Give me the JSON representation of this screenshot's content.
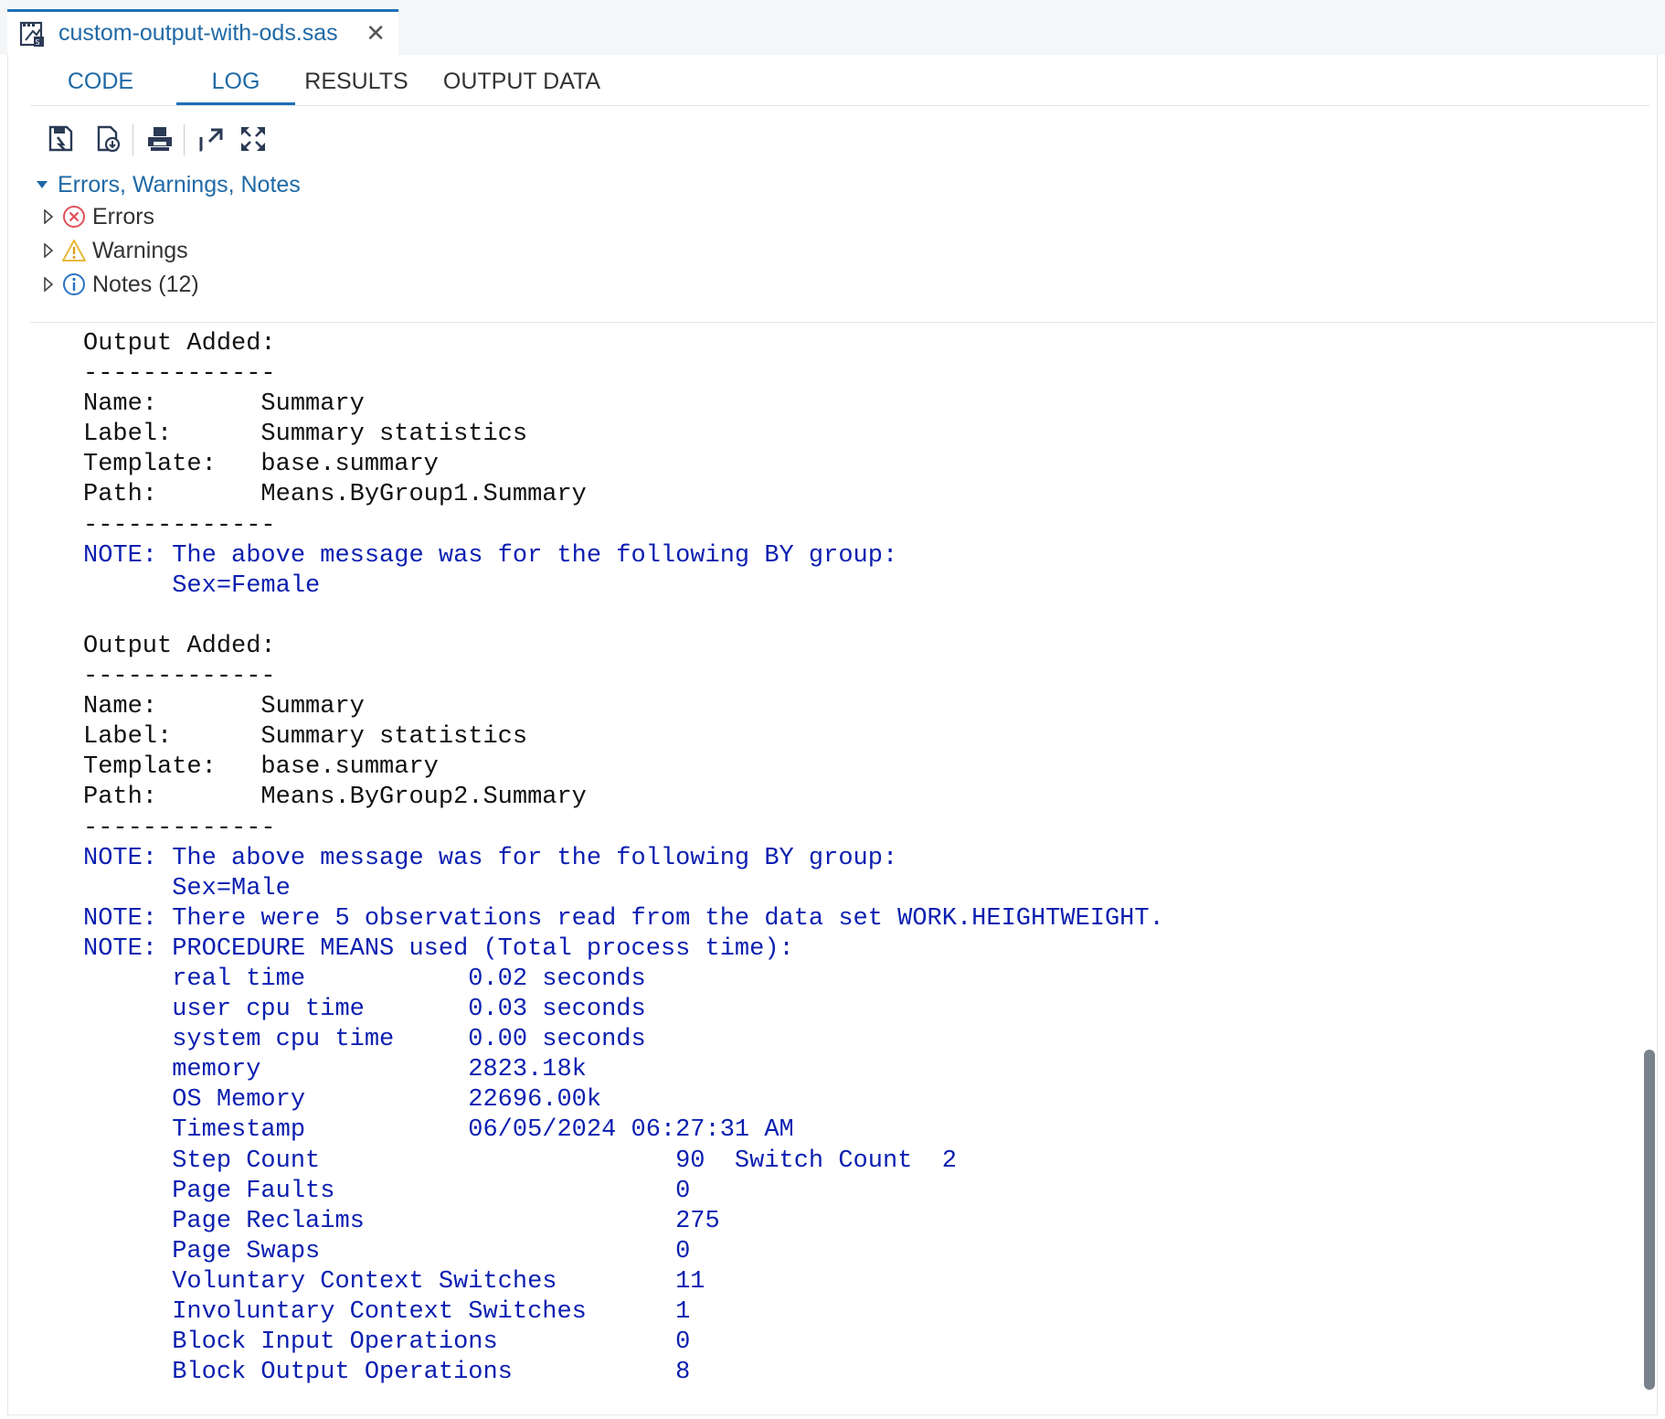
{
  "file_tab": {
    "name": "custom-output-with-ods.sas",
    "close_glyph": "✕"
  },
  "subtabs": {
    "code": "CODE",
    "log": "LOG",
    "results": "RESULTS",
    "output_data": "OUTPUT DATA",
    "active": "LOG"
  },
  "toolbar": {
    "icons": [
      "save-log-icon",
      "download-log-icon",
      "print-icon",
      "popout-icon",
      "maximize-icon"
    ]
  },
  "tree": {
    "root": "Errors, Warnings, Notes",
    "errors": "Errors",
    "warnings": "Warnings",
    "notes": "Notes (12)"
  },
  "log": [
    {
      "text": "Output Added:",
      "type": "plain"
    },
    {
      "text": "-------------",
      "type": "plain"
    },
    {
      "text": "Name:       Summary",
      "type": "plain"
    },
    {
      "text": "Label:      Summary statistics",
      "type": "plain"
    },
    {
      "text": "Template:   base.summary",
      "type": "plain"
    },
    {
      "text": "Path:       Means.ByGroup1.Summary",
      "type": "plain"
    },
    {
      "text": "-------------",
      "type": "plain"
    },
    {
      "text": "NOTE: The above message was for the following BY group:",
      "type": "note"
    },
    {
      "text": "      Sex=Female",
      "type": "note"
    },
    {
      "text": "",
      "type": "plain"
    },
    {
      "text": "Output Added:",
      "type": "plain"
    },
    {
      "text": "-------------",
      "type": "plain"
    },
    {
      "text": "Name:       Summary",
      "type": "plain"
    },
    {
      "text": "Label:      Summary statistics",
      "type": "plain"
    },
    {
      "text": "Template:   base.summary",
      "type": "plain"
    },
    {
      "text": "Path:       Means.ByGroup2.Summary",
      "type": "plain"
    },
    {
      "text": "-------------",
      "type": "plain"
    },
    {
      "text": "NOTE: The above message was for the following BY group:",
      "type": "note"
    },
    {
      "text": "      Sex=Male",
      "type": "note"
    },
    {
      "text": "NOTE: There were 5 observations read from the data set WORK.HEIGHTWEIGHT.",
      "type": "note"
    },
    {
      "text": "NOTE: PROCEDURE MEANS used (Total process time):",
      "type": "note"
    },
    {
      "text": "      real time           0.02 seconds",
      "type": "note"
    },
    {
      "text": "      user cpu time       0.03 seconds",
      "type": "note"
    },
    {
      "text": "      system cpu time     0.00 seconds",
      "type": "note"
    },
    {
      "text": "      memory              2823.18k",
      "type": "note"
    },
    {
      "text": "      OS Memory           22696.00k",
      "type": "note"
    },
    {
      "text": "      Timestamp           06/05/2024 06:27:31 AM",
      "type": "note"
    },
    {
      "text": "      Step Count                        90  Switch Count  2",
      "type": "note"
    },
    {
      "text": "      Page Faults                       0",
      "type": "note"
    },
    {
      "text": "      Page Reclaims                     275",
      "type": "note"
    },
    {
      "text": "      Page Swaps                        0",
      "type": "note"
    },
    {
      "text": "      Voluntary Context Switches        11",
      "type": "note"
    },
    {
      "text": "      Involuntary Context Switches      1",
      "type": "note"
    },
    {
      "text": "      Block Input Operations            0",
      "type": "note"
    },
    {
      "text": "      Block Output Operations           8",
      "type": "note"
    }
  ],
  "colors": {
    "accent": "#1d6fb8",
    "link": "#1f69a6",
    "note": "#0b1fb0",
    "error": "#e0505a",
    "warning": "#e8b93a",
    "info": "#2a73c4"
  }
}
